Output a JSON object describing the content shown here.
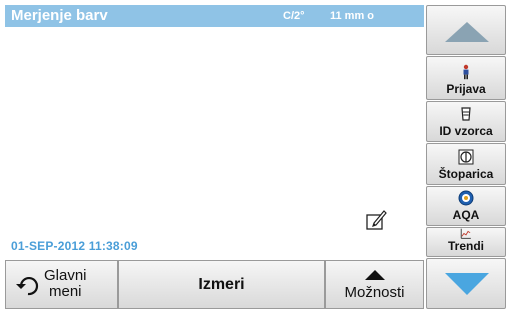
{
  "header": {
    "title": "Merjenje barv",
    "mode": "C/2°",
    "cell": "11 mm o"
  },
  "status": {
    "datetime": "01-SEP-2012  11:38:09"
  },
  "bottom_bar": {
    "home_line1": "Glavni",
    "home_line2": "meni",
    "measure_label": "Izmeri",
    "options_label": "Možnosti"
  },
  "sidebar": {
    "items": [
      {
        "label": "Prijava",
        "icon": "user-login-icon"
      },
      {
        "label": "ID vzorca",
        "icon": "sample-id-icon"
      },
      {
        "label": "Štoparica",
        "icon": "timer-icon"
      },
      {
        "label": "AQA",
        "icon": "aqa-icon"
      },
      {
        "label": "Trendi",
        "icon": "trend-icon"
      }
    ]
  },
  "colors": {
    "title_bar": "#8fc3e6",
    "datetime_text": "#4a9ed8",
    "scroll_down_arrow": "#4aa6e0",
    "scroll_up_arrow": "#8aa3b3"
  }
}
